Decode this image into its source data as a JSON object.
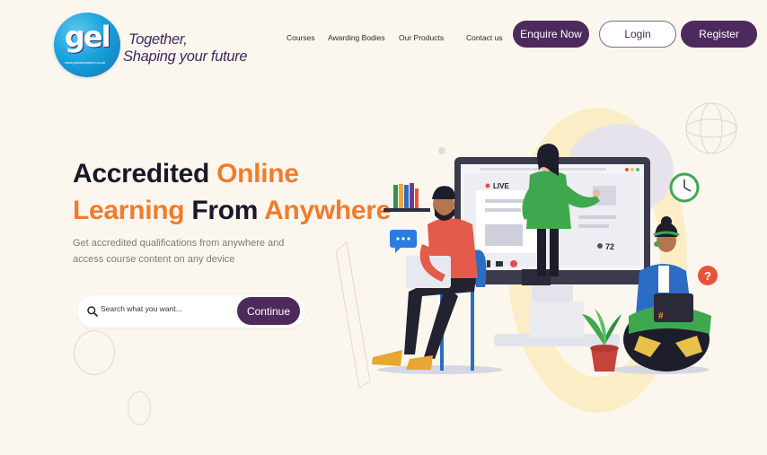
{
  "header": {
    "logo_text": "gel",
    "logo_url": "www.globaledutech.co.uk",
    "tagline_line1": "Together,",
    "tagline_line2": "Shaping your future",
    "nav": [
      "Courses",
      "Awarding Bodies",
      "Our Products",
      "Contact us"
    ],
    "enquire_label": "Enquire Now",
    "login_label": "Login",
    "register_label": "Register"
  },
  "hero": {
    "title_word1": "Accredited",
    "title_word2": "Online",
    "title_word3": "Learning",
    "title_word4": "From",
    "title_word5": "Anywhere",
    "subtitle_line1": "Get accredited qualifications from anywhere and",
    "subtitle_line2": "access course content on any device"
  },
  "search": {
    "placeholder": "Search what you want...",
    "button_label": "Continue"
  },
  "illustration": {
    "live_label": "LIVE",
    "viewer_count": "72",
    "hashtag": "#",
    "question_mark": "?"
  },
  "colors": {
    "background": "#fcf7ee",
    "brand_purple": "#4d2a5c",
    "accent_orange": "#f07c2c",
    "logo_blue": "#1aa2dc"
  },
  "icons": [
    "search-icon",
    "clock-icon",
    "chat-bubble-icon",
    "question-icon",
    "plant-icon",
    "books-icon"
  ]
}
